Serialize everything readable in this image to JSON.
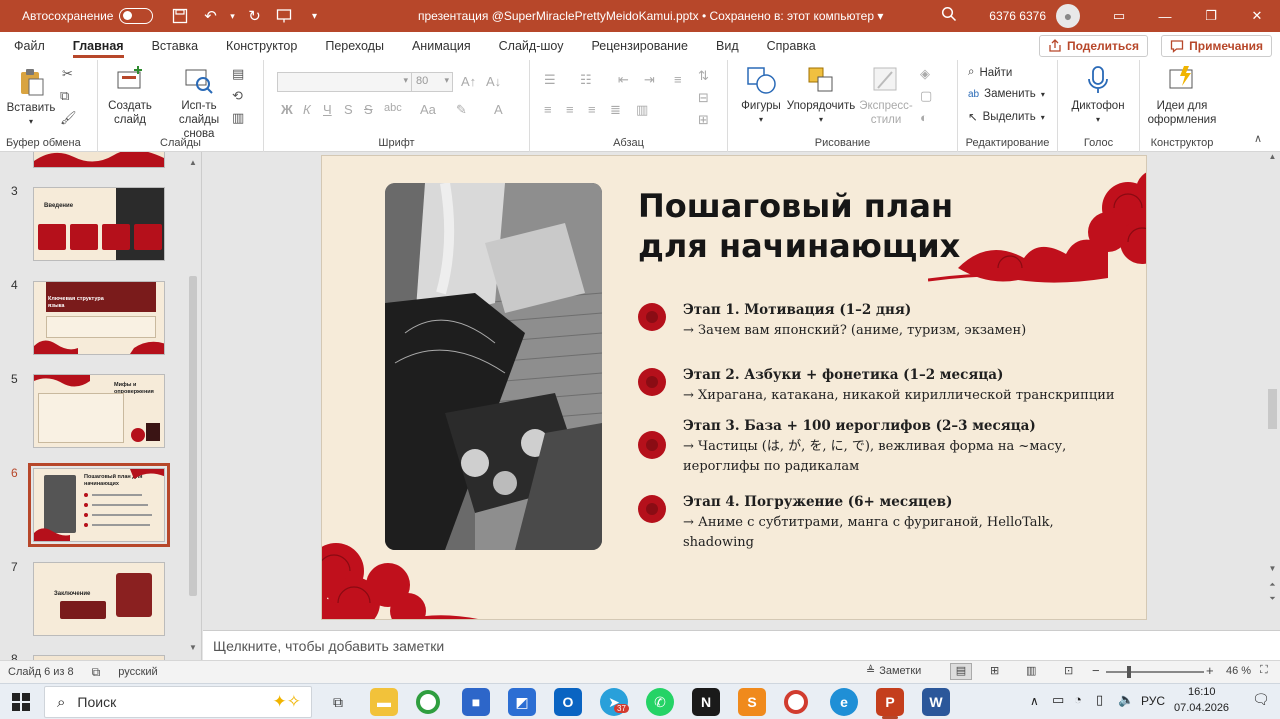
{
  "titlebar": {
    "autosave_label": "Автосохранение",
    "doc_title": "презентация @SuperMiraclePrettyMeidoKamui.pptx  •  Сохранено в: этот компьютер  ▾",
    "user_name": "6376 6376"
  },
  "menu": {
    "items": [
      "Файл",
      "Главная",
      "Вставка",
      "Конструктор",
      "Переходы",
      "Анимация",
      "Слайд-шоу",
      "Рецензирование",
      "Вид",
      "Справка"
    ],
    "share_label": "Поделиться",
    "comments_label": "Примечания"
  },
  "ribbon": {
    "clipboard": {
      "paste": "Вставить",
      "group": "Буфер обмена"
    },
    "slides": {
      "new_slide_1": "Создать",
      "new_slide_2": "слайд",
      "reuse_1": "Исп-ть",
      "reuse_2": "слайды снова",
      "group": "Слайды"
    },
    "font": {
      "group": "Шрифт",
      "size": "80",
      "bold": "Ж",
      "italic": "К",
      "underline": "Ч",
      "strike": "S",
      "charspacing": "abc"
    },
    "paragraph": {
      "group": "Абзац"
    },
    "drawing": {
      "shapes": "Фигуры",
      "arrange": "Упорядочить",
      "styles_1": "Экспресс-",
      "styles_2": "стили",
      "group": "Рисование"
    },
    "editing": {
      "find": "Найти",
      "replace": "Заменить",
      "select": "Выделить",
      "group": "Редактирование"
    },
    "voice": {
      "dictate": "Диктофон",
      "group": "Голос"
    },
    "designer": {
      "ideas_1": "Идеи для",
      "ideas_2": "оформления",
      "group": "Конструктор"
    }
  },
  "thumbnails": [
    {
      "num": "3",
      "title": "Введение"
    },
    {
      "num": "4",
      "title": "Ключевая структура языка"
    },
    {
      "num": "5",
      "title": "Мифы и опровержения"
    },
    {
      "num": "6",
      "title": "Пошаговый план для начинающих"
    },
    {
      "num": "7",
      "title": "Заключение"
    },
    {
      "num": "8"
    }
  ],
  "slide": {
    "title_line1": "Пошаговый план",
    "title_line2": "для начинающих",
    "stages": [
      {
        "head": "Этап 1. Мотивация (1–2 дня)",
        "desc": "→ Зачем вам японский? (аниме, туризм, экзамен)"
      },
      {
        "head": "Этап 2. Азбуки + фонетика (1–2 месяца)",
        "desc": "→ Хирагана, катакана, никакой кириллической транскрипции"
      },
      {
        "head": "Этап 3. База + 100 иероглифов (2–3 месяца)",
        "desc": "→ Частицы (は, が, を, に, で), вежливая форма на ~масу, иероглифы по радикалам"
      },
      {
        "head": "Этап 4. Погружение (6+ месяцев)",
        "desc": "→ Аниме с субтитрами, манга с фуриганой, HelloTalk, shadowing"
      }
    ]
  },
  "notes_placeholder": "Щелкните, чтобы добавить заметки",
  "status": {
    "slide_info": "Слайд 6 из 8",
    "language": "русский",
    "notes_btn": "Заметки",
    "zoom": "46 %"
  },
  "taskbar": {
    "search_placeholder": "Поиск",
    "lang": "РУС",
    "time": "16:10",
    "date": "07.04.2026",
    "telegram_badge": "37"
  },
  "colors": {
    "accent": "#b7472a",
    "slide_bg": "#f6ebd9",
    "dot": "#b5101b"
  }
}
